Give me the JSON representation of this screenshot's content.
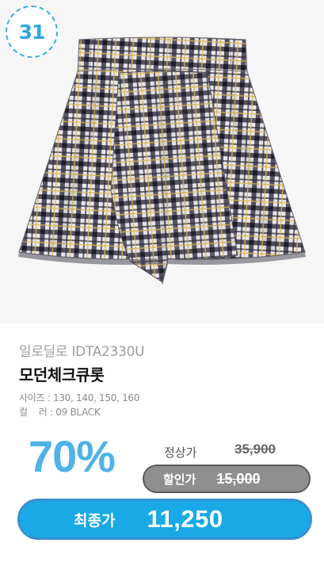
{
  "badge": {
    "number": "31"
  },
  "product": {
    "brand_code": "일로딜로 IDTA2330U",
    "name": "모던체크큐롯",
    "size_line": "사이즈 : 130, 140, 150, 160",
    "color_line": "컬    러 : 09 BLACK"
  },
  "pricing": {
    "discount": "70%",
    "regular_label": "정상가",
    "regular_price": "35,900",
    "sale_label": "할인가",
    "sale_price": "15,000",
    "final_label": "최종가",
    "final_price": "11,250"
  },
  "colors": {
    "accent": "#18a9e6",
    "discount_text": "#4fb2e8",
    "sale_pill": "#8f8f8f"
  },
  "icons": {
    "product_image": "plaid-culotte-shorts"
  }
}
